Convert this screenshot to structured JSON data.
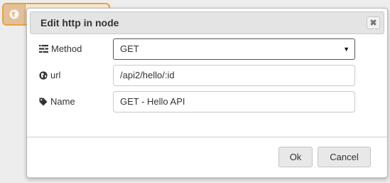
{
  "dialog": {
    "title": "Edit http in node",
    "close_glyph": "✖"
  },
  "form": {
    "method": {
      "label": "Method",
      "icon": "tasks-icon",
      "value": "GET",
      "caret": "▼"
    },
    "url": {
      "label": "url",
      "icon": "globe-icon",
      "value": "/api2/hello/:id"
    },
    "name": {
      "label": "Name",
      "icon": "tag-icon",
      "value": "GET - Hello API"
    }
  },
  "buttons": {
    "ok": "Ok",
    "cancel": "Cancel"
  },
  "colors": {
    "node_fill": "#f7e9d8",
    "node_border": "#e8a33b",
    "titlebar": "#e4e4e4"
  }
}
